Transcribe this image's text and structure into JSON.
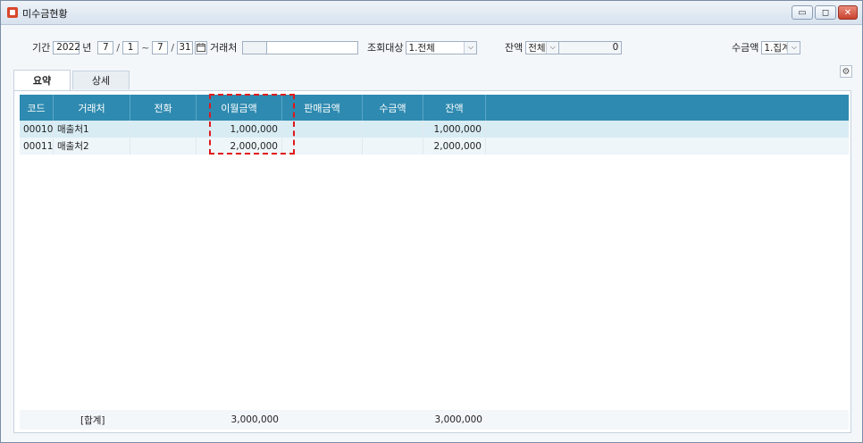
{
  "window": {
    "title": "미수금현황",
    "min_label": "▭",
    "restore_label": "◻",
    "close_label": "✕"
  },
  "filters": {
    "period_label": "기간",
    "year": "2022",
    "year_suffix": "년",
    "from_month": "7",
    "from_day": "1",
    "to_month": "7",
    "to_day": "31",
    "slash": "/",
    "tilde": "~",
    "client_label": "거래처",
    "client_code": "",
    "client_name": "",
    "query_target_label": "조회대상",
    "query_target_value": "1.전체",
    "balance_label": "잔액",
    "balance_mode": "전체",
    "balance_value": "0",
    "receipt_label": "수금액",
    "receipt_value": "1.집계"
  },
  "tabs": [
    {
      "label": "요약",
      "active": true
    },
    {
      "label": "상세",
      "active": false
    }
  ],
  "grid": {
    "columns": [
      "코드",
      "거래처",
      "전화",
      "이월금액",
      "판매금액",
      "수금액",
      "잔액"
    ],
    "rows": [
      {
        "code": "00010",
        "client": "매출처1",
        "phone": "",
        "carryover": "1,000,000",
        "sales": "",
        "receipts": "",
        "balance": "1,000,000"
      },
      {
        "code": "00011",
        "client": "매출처2",
        "phone": "",
        "carryover": "2,000,000",
        "sales": "",
        "receipts": "",
        "balance": "2,000,000"
      }
    ],
    "summary": {
      "label": "[합계]",
      "carryover": "3,000,000",
      "balance": "3,000,000"
    }
  },
  "colors": {
    "header_bg": "#2e8ab0",
    "selected_row": "#d8ecf4",
    "highlight_border": "#e0181c"
  },
  "icons": {
    "calendar": "calendar-icon",
    "dropdown": "chevron-down-icon",
    "settings": "gear-icon",
    "app": "app-icon"
  }
}
